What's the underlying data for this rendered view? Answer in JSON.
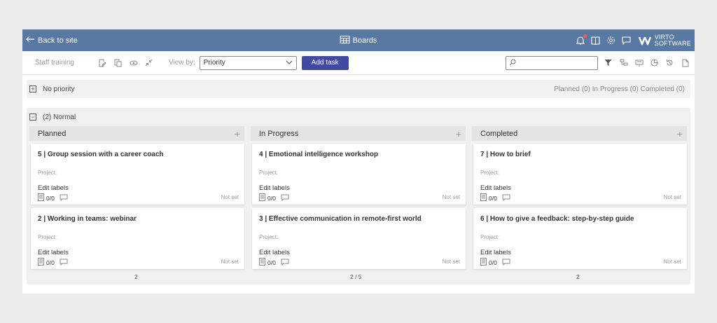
{
  "topbar": {
    "back_label": "Back to site",
    "title": "Boards",
    "logo_line1": "VIRTO",
    "logo_line2": "SOFTWARE",
    "icons": [
      "bell-icon",
      "book-icon",
      "gear-icon",
      "chat-icon"
    ]
  },
  "toolbar": {
    "board_name": "Staff training",
    "view_by_label": "View by:",
    "view_by_value": "Priority",
    "add_task_label": "Add task",
    "search_placeholder": ""
  },
  "groups": {
    "no_priority": {
      "label": "No priority",
      "summary": "Planned (0) In Progress (0) Completed (0)",
      "toggle": "+"
    },
    "normal": {
      "label": "(2) Normal",
      "toggle": "−"
    }
  },
  "columns": [
    {
      "name": "Planned",
      "count": "2",
      "cards": [
        {
          "title": "5 | Group session with a career coach",
          "project": "Project:",
          "labels": "Edit labels",
          "checklist": "0/0",
          "due": "Not set"
        },
        {
          "title": "2 | Working in teams: webinar",
          "project": "Project:",
          "labels": "Edit labels",
          "checklist": "0/0",
          "due": "Not set"
        }
      ]
    },
    {
      "name": "In Progress",
      "count": "2 / 5",
      "cards": [
        {
          "title": "4 | Emotional intelligence workshop",
          "project": "Project:",
          "labels": "Edit labels",
          "checklist": "0/0",
          "due": "Not set"
        },
        {
          "title": "3 | Effective communication in remote-first world",
          "project": "Project:",
          "labels": "Edit labels",
          "checklist": "0/0",
          "due": "Not set"
        }
      ]
    },
    {
      "name": "Completed",
      "count": "2",
      "cards": [
        {
          "title": "7 | How to brief",
          "project": "Project:",
          "labels": "Edit labels",
          "checklist": "0/0",
          "due": "Not set"
        },
        {
          "title": "6 | How to give a feedback: step-by-step guide",
          "project": "Project:",
          "labels": "Edit labels",
          "checklist": "0/0",
          "due": "Not set"
        }
      ]
    }
  ],
  "colors": {
    "topbar": "#5a79a2",
    "add_task": "#3f4aa0",
    "board_bg": "#f0f0f0"
  }
}
